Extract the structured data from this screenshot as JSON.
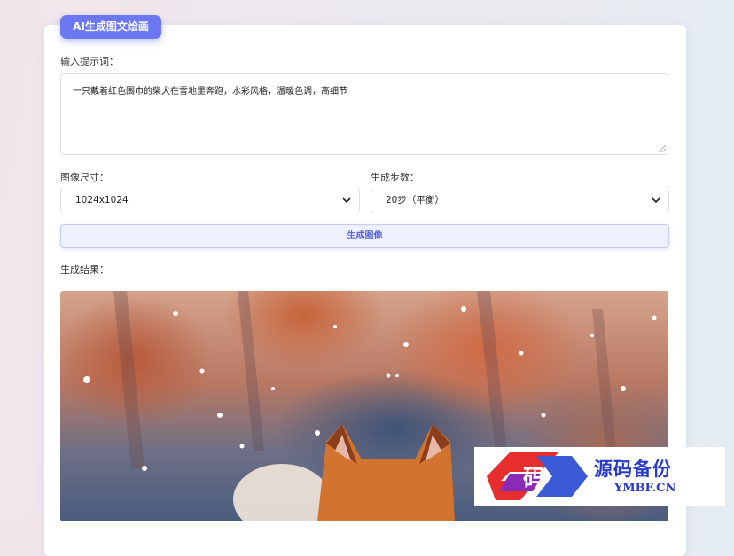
{
  "app": {
    "title": "AI生成图文绘画"
  },
  "prompt": {
    "label": "输入提示词：",
    "value": "一只戴着红色围巾的柴犬在雪地里奔跑，水彩风格，温暖色调，高细节"
  },
  "size": {
    "label": "图像尺寸：",
    "selected": "1024x1024"
  },
  "steps": {
    "label": "生成步数：",
    "selected": "20步（平衡）"
  },
  "generate_button": {
    "label": "生成图像"
  },
  "result": {
    "label": "生成结果："
  },
  "watermark": {
    "big": "源码备份",
    "small": "YMBF.CN",
    "logo_char": "码"
  },
  "colors": {
    "accent": "#6b78f2",
    "button_bg": "#eef0ff",
    "button_text": "#5a64d8"
  }
}
